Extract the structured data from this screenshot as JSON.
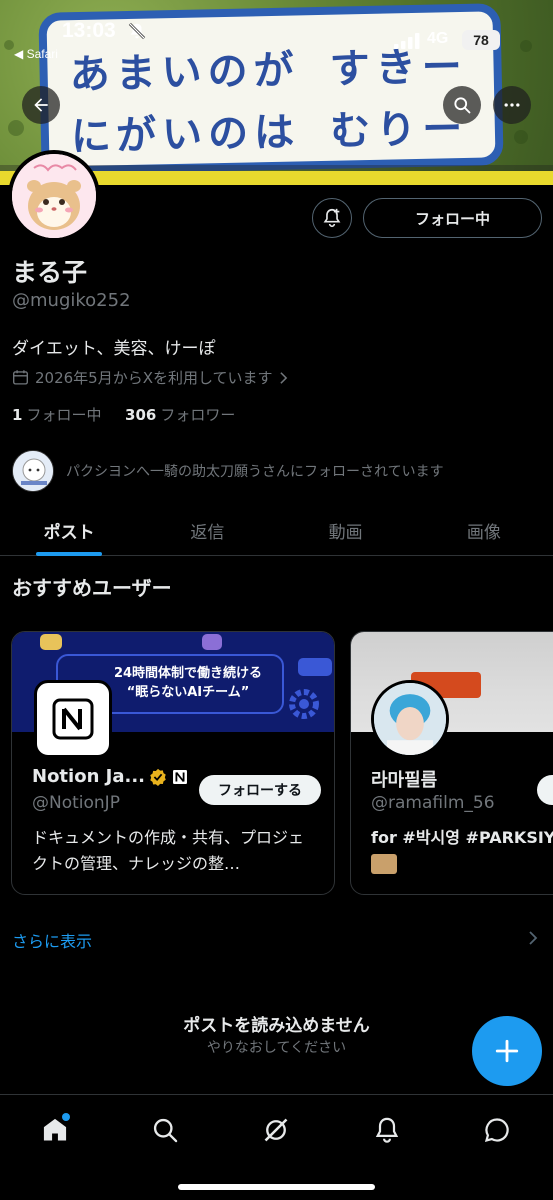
{
  "status_bar": {
    "time": "13:03",
    "back_app": "◀ Safari",
    "network": "4G",
    "battery": "78"
  },
  "banner": {
    "line1": "あまいのが すきー",
    "line2": "にがいのは むりー"
  },
  "profile": {
    "follow_button": "フォロー中",
    "name": "まる子",
    "handle": "@mugiko252",
    "bio": "ダイエット、美容、けーぽ",
    "joined": "2026年5月からXを利用しています",
    "following_count": "1",
    "following_label": "フォロー中",
    "followers_count": "306",
    "followers_label": "フォロワー",
    "followed_by": "パクシヨンへ一騎の助太刀願うさんにフォローされています"
  },
  "tabs": [
    {
      "label": "ポスト",
      "active": true
    },
    {
      "label": "返信",
      "active": false
    },
    {
      "label": "動画",
      "active": false
    },
    {
      "label": "画像",
      "active": false
    }
  ],
  "recommend": {
    "title": "おすすめユーザー",
    "cards": [
      {
        "name": "Notion Ja...",
        "handle": "@NotionJP",
        "follow_label": "フォローする",
        "description": "ドキュメントの作成・共有、プロジェクトの管理、ナレッジの整…",
        "cover_line1": "24時間体制で働き続ける",
        "cover_line2": "“眠らないAIチーム”"
      },
      {
        "name": "라마필름",
        "handle": "@ramafilm_56",
        "description": "for #박시영 #PARKSIY"
      }
    ],
    "show_more": "さらに表示"
  },
  "feed": {
    "error_title": "ポストを読み込めません",
    "error_sub": "やりなおしてください"
  },
  "colors": {
    "accent": "#1d9bf0",
    "background": "#000000",
    "secondary_text": "#71767b"
  },
  "icons": [
    "back-arrow-icon",
    "search-icon",
    "more-icon",
    "notification-plus-icon",
    "calendar-icon",
    "home-icon",
    "grok-icon",
    "bell-icon",
    "messages-icon",
    "plus-icon",
    "verified-badge-icon"
  ]
}
